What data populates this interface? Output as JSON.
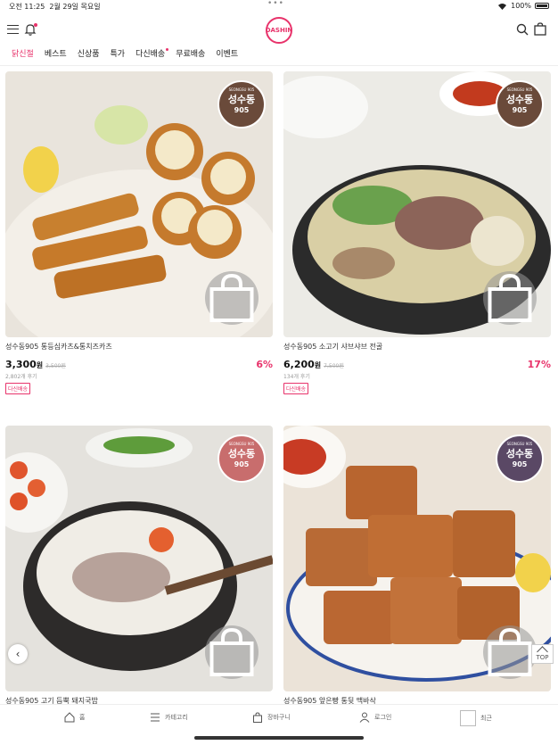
{
  "status": {
    "time": "오전 11:25",
    "date": "2월 29일 목요일",
    "battery": "100%"
  },
  "header": {
    "logo": "DASHIN",
    "icons": [
      "hamburger-menu-icon",
      "bell-icon",
      "search-icon",
      "shopping-bag-icon"
    ]
  },
  "nav": [
    {
      "label": "닭신절",
      "active": true
    },
    {
      "label": "베스트"
    },
    {
      "label": "신상품"
    },
    {
      "label": "특가"
    },
    {
      "label": "다신배송",
      "dot": true
    },
    {
      "label": "무료배송"
    },
    {
      "label": "이벤트"
    }
  ],
  "products": [
    {
      "name": "성수동905 통등심카츠&통치즈카츠",
      "price": "3,300",
      "unit": "원",
      "original": "3,500원",
      "reviews": "2,802개 후기",
      "discount": "6%",
      "badge": "다신배송",
      "stamp_top": "SEONGSU 905",
      "stamp_main": "성수동",
      "stamp_num": "905"
    },
    {
      "name": "성수동905 소고기 샤브샤브 전골",
      "price": "6,200",
      "unit": "원",
      "original": "7,500원",
      "reviews": "134개 후기",
      "discount": "17%",
      "badge": "다신배송",
      "stamp_top": "SEONGSU 905",
      "stamp_main": "성수동",
      "stamp_num": "905"
    },
    {
      "name": "성수동905 고기 듬뿍 돼지국밥",
      "stamp_top": "SEONGSU 905",
      "stamp_main": "성수동",
      "stamp_num": "905"
    },
    {
      "name": "성수동905 앞은빵 통뒷 맥바삭",
      "stamp_top": "SEONGSU 905",
      "stamp_main": "성수동",
      "stamp_num": "905"
    }
  ],
  "top_button": "TOP",
  "bottom_tabs": [
    {
      "label": "홈",
      "icon": "home-icon"
    },
    {
      "label": "카테고리",
      "icon": "category-list-icon"
    },
    {
      "label": "장바구니",
      "icon": "cart-bag-icon"
    },
    {
      "label": "로그인",
      "icon": "person-icon"
    },
    {
      "label": "최근",
      "icon": "recent-thumbnail-icon"
    }
  ],
  "colors": {
    "accent": "#e8336b"
  }
}
